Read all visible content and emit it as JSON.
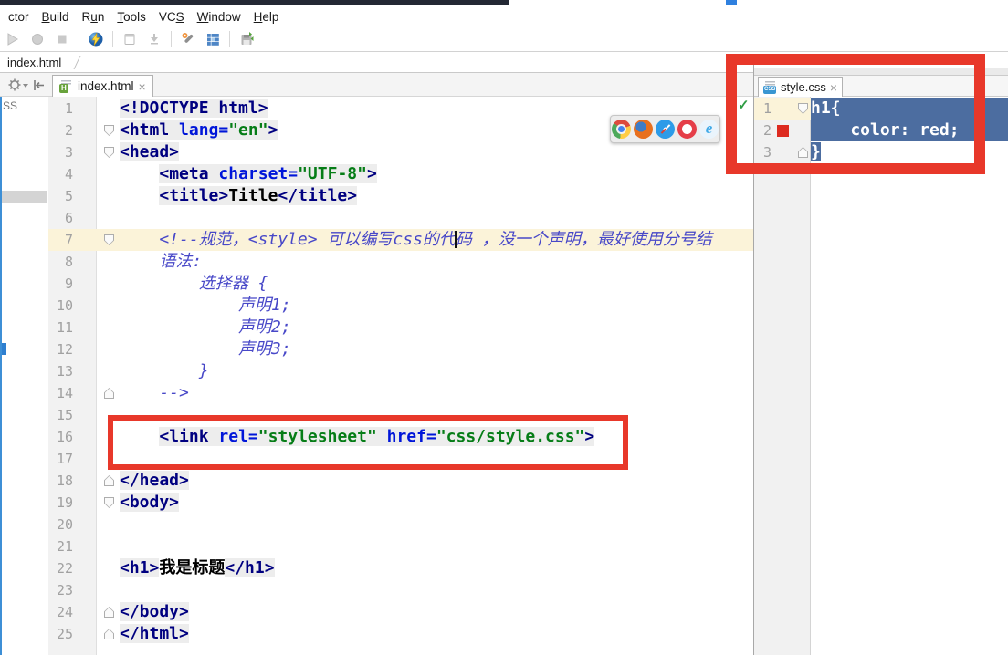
{
  "colors": {
    "annotation": "#E8382A",
    "sel": "#4C6DA0",
    "caret_row": "#FBF3D9",
    "chip": "#DD2B20",
    "tag": "#000080",
    "attr": "#0016D9",
    "val": "#067D17",
    "com": "#4848C8"
  },
  "menubar": {
    "items": [
      {
        "pre": "ctor",
        "mn": "",
        "post": ""
      },
      {
        "pre": "",
        "mn": "B",
        "post": "uild"
      },
      {
        "pre": "R",
        "mn": "u",
        "post": "n"
      },
      {
        "pre": "",
        "mn": "T",
        "post": "ools"
      },
      {
        "pre": "VC",
        "mn": "S",
        "post": ""
      },
      {
        "pre": "",
        "mn": "W",
        "post": "indow"
      },
      {
        "pre": "",
        "mn": "H",
        "post": "elp"
      }
    ]
  },
  "toolbar": {
    "icons": [
      "run-disabled-icon",
      "debug-disabled-icon",
      "stop-disabled-icon",
      "coverage-run-icon",
      "window-disabled-icon",
      "update-disabled-icon",
      "settings-wrench-icon",
      "project-structure-icon",
      "save-all-icon"
    ]
  },
  "breadcrumb": {
    "label": "index.html"
  },
  "project_panel": {
    "visible_label": "SS"
  },
  "editor": {
    "tab": {
      "label": "index.html",
      "close": "×",
      "icon_badge": "H"
    },
    "caret_line": 7,
    "lines": [
      {
        "n": 1,
        "tokens": [
          {
            "c": "tag",
            "t": "<!DOCTYPE html>"
          }
        ]
      },
      {
        "n": 2,
        "fold": "down",
        "tokens": [
          {
            "c": "tag",
            "t": "<html "
          },
          {
            "c": "attr",
            "t": "lang="
          },
          {
            "c": "val",
            "t": "\"en\""
          },
          {
            "c": "tag",
            "t": ">"
          }
        ]
      },
      {
        "n": 3,
        "fold": "down",
        "tokens": [
          {
            "c": "tag",
            "t": "<head>"
          }
        ]
      },
      {
        "n": 4,
        "tokens": [
          {
            "c": "txt",
            "t": "    "
          },
          {
            "c": "tag",
            "t": "<meta "
          },
          {
            "c": "attr",
            "t": "charset="
          },
          {
            "c": "val",
            "t": "\"UTF-8\""
          },
          {
            "c": "tag",
            "t": ">"
          }
        ]
      },
      {
        "n": 5,
        "tokens": [
          {
            "c": "txt",
            "t": "    "
          },
          {
            "c": "tag",
            "t": "<title>"
          },
          {
            "c": "txt",
            "t": "Title"
          },
          {
            "c": "tag",
            "t": "</title>"
          }
        ]
      },
      {
        "n": 6,
        "tokens": []
      },
      {
        "n": 7,
        "fold": "down",
        "caret_row": true,
        "tokens": [
          {
            "c": "com",
            "t": "    <!--规范，<style> 可以编写css的代"
          },
          {
            "c": "caret",
            "t": ""
          },
          {
            "c": "com",
            "t": "码 ，没一个声明，最好使用分号结"
          }
        ]
      },
      {
        "n": 8,
        "tokens": [
          {
            "c": "com",
            "t": "    语法:"
          }
        ]
      },
      {
        "n": 9,
        "tokens": [
          {
            "c": "com",
            "t": "        选择器 {"
          }
        ]
      },
      {
        "n": 10,
        "tokens": [
          {
            "c": "com",
            "t": "            声明1;"
          }
        ]
      },
      {
        "n": 11,
        "tokens": [
          {
            "c": "com",
            "t": "            声明2;"
          }
        ]
      },
      {
        "n": 12,
        "tokens": [
          {
            "c": "com",
            "t": "            声明3;"
          }
        ]
      },
      {
        "n": 13,
        "tokens": [
          {
            "c": "com",
            "t": "        }"
          }
        ]
      },
      {
        "n": 14,
        "fold": "up",
        "tokens": [
          {
            "c": "com",
            "t": "    -->"
          }
        ]
      },
      {
        "n": 15,
        "tokens": []
      },
      {
        "n": 16,
        "tokens": [
          {
            "c": "txt",
            "t": "    "
          },
          {
            "c": "tag",
            "t": "<link "
          },
          {
            "c": "attr",
            "t": "rel="
          },
          {
            "c": "val",
            "t": "\"stylesheet\""
          },
          {
            "c": "attr",
            "t": " href="
          },
          {
            "c": "val",
            "t": "\"css/style.css\""
          },
          {
            "c": "tag",
            "t": ">"
          }
        ]
      },
      {
        "n": 17,
        "tokens": []
      },
      {
        "n": 18,
        "fold": "up",
        "tokens": [
          {
            "c": "tag",
            "t": "</head>"
          }
        ]
      },
      {
        "n": 19,
        "fold": "down",
        "tokens": [
          {
            "c": "tag",
            "t": "<body>"
          }
        ]
      },
      {
        "n": 20,
        "tokens": []
      },
      {
        "n": 21,
        "tokens": []
      },
      {
        "n": 22,
        "tokens": [
          {
            "c": "tag",
            "t": "<h1>"
          },
          {
            "c": "txt",
            "t": "我是标题"
          },
          {
            "c": "tag",
            "t": "</h1>"
          }
        ]
      },
      {
        "n": 23,
        "tokens": []
      },
      {
        "n": 24,
        "fold": "up",
        "tokens": [
          {
            "c": "tag",
            "t": "</body>"
          }
        ]
      },
      {
        "n": 25,
        "fold": "up",
        "tokens": [
          {
            "c": "tag",
            "t": "</html>"
          }
        ]
      }
    ]
  },
  "overlay": {
    "tab": {
      "label": "style.css",
      "close": "×",
      "icon_badge": "CSS"
    },
    "status_icon": "✓",
    "lines": [
      {
        "n": 1,
        "fold": "down",
        "caret_row": true,
        "selection": "full",
        "tokens": [
          {
            "t": "h1{"
          }
        ]
      },
      {
        "n": 2,
        "color_chip": true,
        "selection": "full",
        "tokens": [
          {
            "t": "    color: red;"
          }
        ]
      },
      {
        "n": 3,
        "fold": "up",
        "selection": "token",
        "tokens": [
          {
            "t": "}"
          }
        ]
      }
    ]
  },
  "browser_popup": {
    "browsers": [
      "chrome",
      "firefox",
      "safari",
      "opera",
      "ie"
    ]
  }
}
